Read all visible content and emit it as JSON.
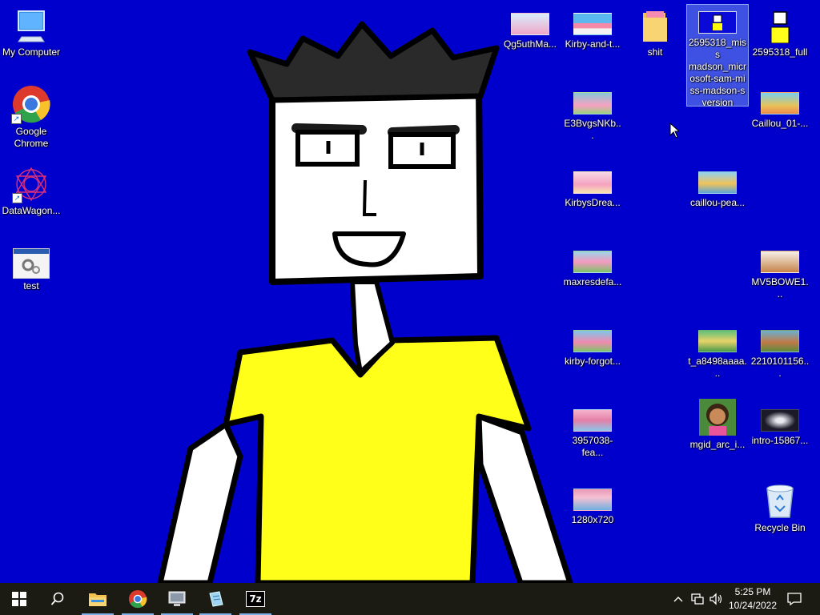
{
  "desktop": {
    "background_color": "#0000cc",
    "left_icons": [
      {
        "label": "My Computer",
        "icon": "computer-icon"
      },
      {
        "label": "Google Chrome",
        "icon": "chrome-icon"
      },
      {
        "label": "DataWagon...",
        "icon": "datawagon-icon"
      },
      {
        "label": "test",
        "icon": "settings-file-icon"
      }
    ],
    "file_icons": [
      {
        "label": "Qg5uthMa...",
        "icon": "kirby-image-icon"
      },
      {
        "label": "Kirby-and-t...",
        "icon": "kirby-image-icon"
      },
      {
        "label": "shit",
        "icon": "folder-icon"
      },
      {
        "label": "2595318_miss madson_micr osoft-sam-mi ss-madson-s version",
        "icon": "image-icon"
      },
      {
        "label": "2595318_full",
        "icon": "image-icon"
      },
      {
        "label": "E3BvgsNKb...",
        "icon": "kirby-image-icon"
      },
      {
        "label": "Caillou_01-...",
        "icon": "caillou-image-icon"
      },
      {
        "label": "KirbysDrea...",
        "icon": "kirby-image-icon"
      },
      {
        "label": "caillou-pea...",
        "icon": "caillou-image-icon"
      },
      {
        "label": "maxresdefa...",
        "icon": "kirby-image-icon"
      },
      {
        "label": "MV5BOWE1...",
        "icon": "image-icon"
      },
      {
        "label": "kirby-forgot...",
        "icon": "kirby-image-icon"
      },
      {
        "label": "t_a8498aaaa...",
        "icon": "image-icon"
      },
      {
        "label": "2210101156...",
        "icon": "image-icon"
      },
      {
        "label": "3957038-fea...",
        "icon": "kirby-image-icon"
      },
      {
        "label": "mgid_arc_i...",
        "icon": "dora-image-icon"
      },
      {
        "label": "intro-15867...",
        "icon": "image-icon"
      },
      {
        "label": "1280x720",
        "icon": "kirby-image-icon"
      },
      {
        "label": "Recycle Bin",
        "icon": "recycle-bin-icon"
      }
    ]
  },
  "taskbar": {
    "background_color": "#1b1b14",
    "buttons": [
      {
        "name": "start",
        "icon": "windows-logo-icon"
      },
      {
        "name": "search",
        "icon": "search-icon"
      },
      {
        "name": "file-explorer",
        "icon": "folder-icon"
      },
      {
        "name": "chrome",
        "icon": "chrome-icon"
      },
      {
        "name": "app-1",
        "icon": "monitor-app-icon"
      },
      {
        "name": "app-2",
        "icon": "notepad-icon"
      },
      {
        "name": "7zip",
        "icon": "7zip-icon",
        "text": "7z"
      }
    ],
    "tray": {
      "clock_time": "5:25 PM",
      "clock_date": "10/24/2022"
    }
  }
}
